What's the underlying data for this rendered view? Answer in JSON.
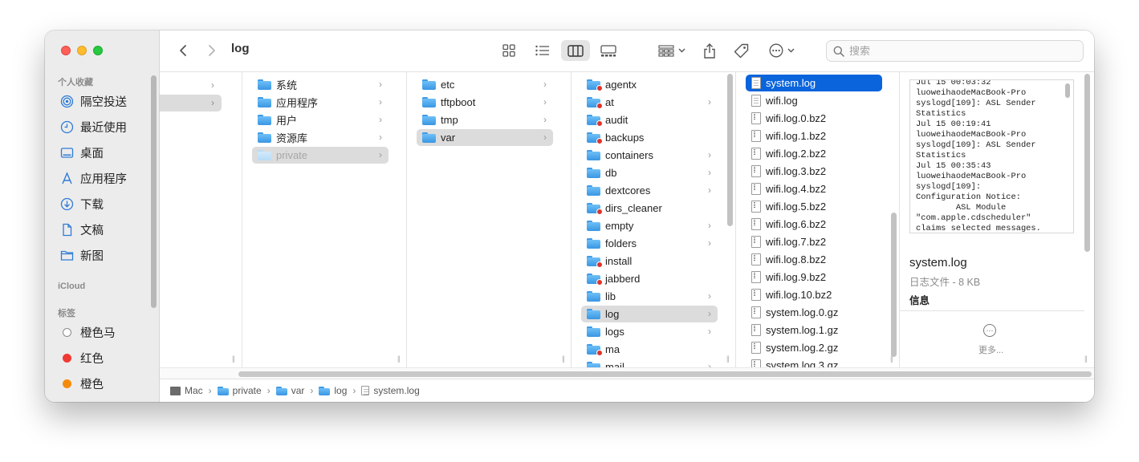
{
  "window": {
    "title": "log"
  },
  "sidebar": {
    "favorites_header": "个人收藏",
    "favorites": [
      {
        "label": "隔空投送",
        "icon": "airdrop-icon"
      },
      {
        "label": "最近使用",
        "icon": "clock-icon"
      },
      {
        "label": "桌面",
        "icon": "desktop-icon"
      },
      {
        "label": "应用程序",
        "icon": "applications-icon"
      },
      {
        "label": "下载",
        "icon": "download-icon"
      },
      {
        "label": "文稿",
        "icon": "document-icon"
      },
      {
        "label": "新图",
        "icon": "folder-icon"
      }
    ],
    "icloud_header": "iCloud",
    "tags_header": "标签",
    "tags": [
      {
        "label": "橙色马",
        "color": "#ffffff"
      },
      {
        "label": "红色",
        "color": "#ef3a34"
      },
      {
        "label": "橙色",
        "color": "#f58a0b"
      }
    ]
  },
  "toolbar": {
    "search_placeholder": "搜索",
    "view_modes": [
      "icon-view-icon",
      "list-view-icon",
      "column-view-icon",
      "gallery-view-icon"
    ],
    "active_view": "column-view-icon"
  },
  "columns": {
    "col2": [
      {
        "name": "系统",
        "chevron": true
      },
      {
        "name": "应用程序",
        "chevron": true
      },
      {
        "name": "用户",
        "chevron": true
      },
      {
        "name": "资源库",
        "chevron": true
      },
      {
        "name": "private",
        "chevron": true,
        "selected": true,
        "dim": true
      }
    ],
    "col3": [
      {
        "name": "etc",
        "chevron": true
      },
      {
        "name": "tftpboot",
        "chevron": true
      },
      {
        "name": "tmp",
        "chevron": true
      },
      {
        "name": "var",
        "chevron": true,
        "selected": true
      }
    ],
    "col4": [
      {
        "name": "agentx",
        "badge": true
      },
      {
        "name": "at",
        "badge": true,
        "chevron": true
      },
      {
        "name": "audit",
        "badge": true
      },
      {
        "name": "backups",
        "badge": true
      },
      {
        "name": "containers",
        "chevron": true
      },
      {
        "name": "db",
        "chevron": true
      },
      {
        "name": "dextcores",
        "chevron": true
      },
      {
        "name": "dirs_cleaner",
        "badge": true
      },
      {
        "name": "empty",
        "chevron": true
      },
      {
        "name": "folders",
        "chevron": true
      },
      {
        "name": "install",
        "badge": true
      },
      {
        "name": "jabberd",
        "badge": true
      },
      {
        "name": "lib",
        "chevron": true
      },
      {
        "name": "log",
        "chevron": true,
        "selected": true
      },
      {
        "name": "logs",
        "chevron": true
      },
      {
        "name": "ma",
        "badge": true
      },
      {
        "name": "mail",
        "chevron": true
      }
    ],
    "col5": [
      {
        "name": "system.log",
        "kind": "doc",
        "selected": true
      },
      {
        "name": "wifi.log",
        "kind": "doc"
      },
      {
        "name": "wifi.log.0.bz2",
        "kind": "zip"
      },
      {
        "name": "wifi.log.1.bz2",
        "kind": "zip"
      },
      {
        "name": "wifi.log.2.bz2",
        "kind": "zip"
      },
      {
        "name": "wifi.log.3.bz2",
        "kind": "zip"
      },
      {
        "name": "wifi.log.4.bz2",
        "kind": "zip"
      },
      {
        "name": "wifi.log.5.bz2",
        "kind": "zip"
      },
      {
        "name": "wifi.log.6.bz2",
        "kind": "zip"
      },
      {
        "name": "wifi.log.7.bz2",
        "kind": "zip"
      },
      {
        "name": "wifi.log.8.bz2",
        "kind": "zip"
      },
      {
        "name": "wifi.log.9.bz2",
        "kind": "zip"
      },
      {
        "name": "wifi.log.10.bz2",
        "kind": "zip"
      },
      {
        "name": "system.log.0.gz",
        "kind": "zip"
      },
      {
        "name": "system.log.1.gz",
        "kind": "zip"
      },
      {
        "name": "system.log.2.gz",
        "kind": "zip"
      },
      {
        "name": "system.log.3.gz",
        "kind": "zip"
      }
    ]
  },
  "preview": {
    "text": "Jul 15 00:03:32\nluoweihaodeMacBook-Pro\nsyslogd[109]: ASL Sender\nStatistics\nJul 15 00:19:41\nluoweihaodeMacBook-Pro\nsyslogd[109]: ASL Sender\nStatistics\nJul 15 00:35:43\nluoweihaodeMacBook-Pro\nsyslogd[109]:\nConfiguration Notice:\n        ASL Module\n\"com.apple.cdscheduler\"\nclaims selected messages.",
    "file_name": "system.log",
    "file_meta": "日志文件 - 8 KB",
    "info_label": "信息",
    "more_label": "更多..."
  },
  "pathbar": [
    {
      "label": "Mac",
      "icon": "mac-icon"
    },
    {
      "label": "private",
      "icon": "folder-icon"
    },
    {
      "label": "var",
      "icon": "folder-icon"
    },
    {
      "label": "log",
      "icon": "folder-icon"
    },
    {
      "label": "system.log",
      "icon": "document-icon"
    }
  ]
}
